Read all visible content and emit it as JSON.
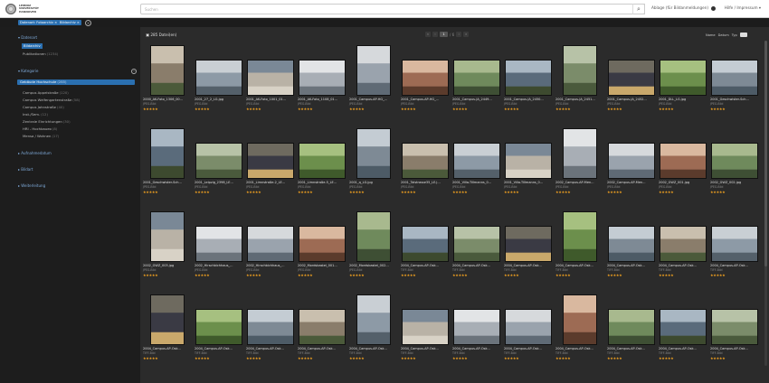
{
  "header": {
    "logo_text_line1": "LEIBNIZ",
    "logo_text_line2": "UNIVERSITÄT",
    "logo_text_line3": "HANNOVER",
    "search_placeholder": "Suchen",
    "search_icon": "magnifier-icon",
    "right_text": "Ablage (für Bildanmeldungen)",
    "help_menu": "Hilfe / Impressum ▾"
  },
  "filters": {
    "chip1": "Datenart: Fotoarchiv ×",
    "chip2": "Bildarchiv ×"
  },
  "sidebar": {
    "section_datenart": "▾ Datenart",
    "datenart_items": [
      {
        "label": "Bildarchiv",
        "count": "",
        "selected": true
      },
      {
        "label": "Publikationen",
        "count": "(1234)",
        "selected": false
      }
    ],
    "section_kategorie": "▾ Kategorie",
    "kategorie_selected": {
      "label": "Gebäude Hochschule",
      "count": "(285)"
    },
    "kategorie_items": [
      {
        "label": "Campus Appelstraße",
        "count": "(120)"
      },
      {
        "label": "Campus Welfengartenstraße",
        "count": "(58)"
      },
      {
        "label": "Campus Jahnstraße",
        "count": "(40)"
      },
      {
        "label": "Inst./Sem.",
        "count": "(12)"
      },
      {
        "label": "Zentrale Einrichtungen",
        "count": "(30)"
      },
      {
        "label": "HRI - Hochbaueo",
        "count": "(8)"
      },
      {
        "label": "Mensa / Wohnen",
        "count": "(17)"
      }
    ],
    "section_aufnahmedatum": "▸ Aufnahmedatum",
    "section_bildart": "▸ Bildart",
    "section_weiterleitung": "▸ Weiterleitung"
  },
  "toolbar": {
    "result_count": "285 Datei(en)",
    "page_current": "1",
    "page_total": "/ 6",
    "sort_name": "Name",
    "sort_datum": "Datum",
    "sort_typ": "Typ"
  },
  "images": [
    {
      "name": "2000_AK-Foto_1306_00...",
      "size": "JPEG-Bild",
      "stars": "★★★★★"
    },
    {
      "name": "2001_27_2_LG.jpg",
      "size": "JPEG-Bild",
      "stars": "★★★★★"
    },
    {
      "name": "2001_AK-Foto_1001_01...",
      "size": "JPEG-Bild",
      "stars": "★★★★★"
    },
    {
      "name": "2001_AK-Foto_1108_01...",
      "size": "JPEG-Bild",
      "stars": "★★★★★"
    },
    {
      "name": "2001_Campus-AP-HG_...",
      "size": "JPEG-Bild",
      "stars": "★★★★★"
    },
    {
      "name": "2001_Campus-AP-HG_...",
      "size": "JPEG-Bild",
      "stars": "★★★★★"
    },
    {
      "name": "2001_Campus-JA_2449...",
      "size": "JPEG-Bild",
      "stars": "★★★★★"
    },
    {
      "name": "2001_Campus-JA_2450...",
      "size": "JPEG-Bild",
      "stars": "★★★★★"
    },
    {
      "name": "2001_Campus-JA_2451...",
      "size": "JPEG-Bild",
      "stars": "★★★★★"
    },
    {
      "name": "2001_Campus-JA_2452...",
      "size": "JPEG-Bild",
      "stars": "★★★★★"
    },
    {
      "name": "2001_DLL_LG.jpg",
      "size": "JPEG-Bild",
      "stars": "★★★★★"
    },
    {
      "name": "2001_Geschwister-Sch...",
      "size": "JPEG-Bild",
      "stars": "★★★★★"
    },
    {
      "name": "2001_Geschwister-Sch...",
      "size": "JPEG-Bild",
      "stars": "★★★★★"
    },
    {
      "name": "2001_Leipzig_2398_LE...",
      "size": "JPEG-Bild",
      "stars": "★★★★★"
    },
    {
      "name": "2001_Limnstraße-2_LE...",
      "size": "JPEG-Bild",
      "stars": "★★★★★"
    },
    {
      "name": "2001_Limnstraße-5_LE...",
      "size": "JPEG-Bild",
      "stars": "★★★★★"
    },
    {
      "name": "2001_q_LG.jpg",
      "size": "JPEG-Bild",
      "stars": "★★★★★"
    },
    {
      "name": "2001_Talstrasse35_LE.j...",
      "size": "JPEG-Bild",
      "stars": "★★★★★"
    },
    {
      "name": "2001_Villa-Tillmanns_0...",
      "size": "JPEG-Bild",
      "stars": "★★★★★"
    },
    {
      "name": "2001_Villa-Tillmanns_0...",
      "size": "JPEG-Bild",
      "stars": "★★★★★"
    },
    {
      "name": "2002_Campus-AP-Men...",
      "size": "JPEG-Bild",
      "stars": "★★★★★"
    },
    {
      "name": "2002_Campus-AP-Men...",
      "size": "JPEG-Bild",
      "stars": "★★★★★"
    },
    {
      "name": "2002_GWZ_001.jpg",
      "size": "JPEG-Bild",
      "stars": "★★★★★"
    },
    {
      "name": "2002_GWZ_002.jpg",
      "size": "JPEG-Bild",
      "stars": "★★★★★"
    },
    {
      "name": "2002_GWZ_003.jpg",
      "size": "JPEG-Bild",
      "stars": "★★★★★"
    },
    {
      "name": "2002_Hirschbichhaus_...",
      "size": "JPEG-Bild",
      "stars": "★★★★★"
    },
    {
      "name": "2002_Hirschbichhaus_...",
      "size": "JPEG-Bild",
      "stars": "★★★★★"
    },
    {
      "name": "2002_Mordsbastei_001...",
      "size": "JPEG-Bild",
      "stars": "★★★★★"
    },
    {
      "name": "2002_Mordsbastei_002...",
      "size": "JPEG-Bild",
      "stars": "★★★★★"
    },
    {
      "name": "2004_Campus-AP-Osk...",
      "size": "TIFF-Bild",
      "stars": "★★★★★"
    },
    {
      "name": "2004_Campus-AP-Osk...",
      "size": "TIFF-Bild",
      "stars": "★★★★★"
    },
    {
      "name": "2004_Campus-AP-Osk...",
      "size": "TIFF-Bild",
      "stars": "★★★★★"
    },
    {
      "name": "2004_Campus-AP-Osk...",
      "size": "TIFF-Bild",
      "stars": "★★★★★"
    },
    {
      "name": "2004_Campus-AP-Osk...",
      "size": "TIFF-Bild",
      "stars": "★★★★★"
    },
    {
      "name": "2004_Campus-AP-Osk...",
      "size": "TIFF-Bild",
      "stars": "★★★★★"
    },
    {
      "name": "2004_Campus-AP-Osk...",
      "size": "TIFF-Bild",
      "stars": "★★★★★"
    },
    {
      "name": "2004_Campus-AP-Osk...",
      "size": "TIFF-Bild",
      "stars": "★★★★★"
    },
    {
      "name": "2004_Campus-AP-Osk...",
      "size": "TIFF-Bild",
      "stars": "★★★★★"
    },
    {
      "name": "2004_Campus-AP-Osk...",
      "size": "TIFF-Bild",
      "stars": "★★★★★"
    },
    {
      "name": "2004_Campus-AP-Osk...",
      "size": "TIFF-Bild",
      "stars": "★★★★★"
    },
    {
      "name": "2004_Campus-AP-Osk...",
      "size": "TIFF-Bild",
      "stars": "★★★★★"
    },
    {
      "name": "2004_Campus-AP-Osk...",
      "size": "TIFF-Bild",
      "stars": "★★★★★"
    },
    {
      "name": "2004_Campus-AP-Osk...",
      "size": "TIFF-Bild",
      "stars": "★★★★★"
    },
    {
      "name": "2004_Campus-AP-Osk...",
      "size": "TIFF-Bild",
      "stars": "★★★★★"
    },
    {
      "name": "2004_Campus-AP-Osk...",
      "size": "TIFF-Bild",
      "stars": "★★★★★"
    },
    {
      "name": "2004_Campus-AP-Osk...",
      "size": "TIFF-Bild",
      "stars": "★★★★★"
    },
    {
      "name": "2004_Campus-AP-Osk...",
      "size": "TIFF-Bild",
      "stars": "★★★★★"
    },
    {
      "name": "2004_Campus-AP-Osk...",
      "size": "TIFF-Bild",
      "stars": "★★★★★"
    }
  ],
  "colors": {
    "accent": "#2a6fb0",
    "star": "#f0a020",
    "sidebar_bg": "#1d1d1d",
    "main_bg": "#2b2b2b"
  }
}
